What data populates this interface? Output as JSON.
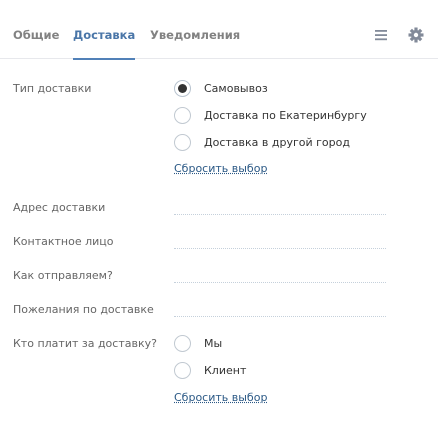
{
  "tabs": [
    {
      "label": "Общие"
    },
    {
      "label": "Доставка"
    },
    {
      "label": "Уведомления"
    }
  ],
  "toolbar": {
    "menu_icon": "hamburger-menu-icon",
    "settings_icon": "gear-icon"
  },
  "delivery_type": {
    "label": "Тип доставки",
    "options": [
      {
        "label": "Самовывоз",
        "checked": true
      },
      {
        "label": "Доставка по Екатеринбургу",
        "checked": false
      },
      {
        "label": "Доставка в другой город",
        "checked": false
      }
    ],
    "reset_label": "Сбросить выбор"
  },
  "fields": [
    {
      "label": "Адрес доставки",
      "value": ""
    },
    {
      "label": "Контактное лицо",
      "value": ""
    },
    {
      "label": "Как отправляем?",
      "value": ""
    },
    {
      "label": "Пожелания по доставке",
      "value": ""
    }
  ],
  "payer": {
    "label": "Кто платит за доставку?",
    "options": [
      {
        "label": "Мы",
        "checked": false
      },
      {
        "label": "Клиент",
        "checked": false
      }
    ],
    "reset_label": "Сбросить выбор"
  },
  "colors": {
    "accent": "#4a76a8",
    "link": "#2a5885",
    "muted_text": "#828282"
  }
}
